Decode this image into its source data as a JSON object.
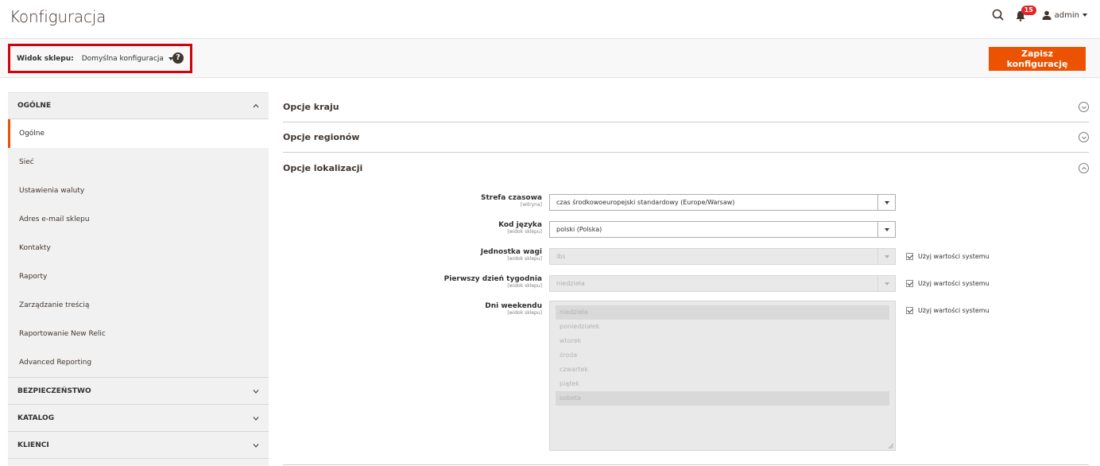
{
  "header": {
    "title": "Konfiguracja",
    "notifications_count": "15",
    "user": "admin"
  },
  "toolbar": {
    "scope_label": "Widok sklepu:",
    "scope_value": "Domyślna konfiguracja",
    "save_label": "Zapisz konfigurację"
  },
  "sidebar": {
    "general_section": "OGÓLNE",
    "items": [
      {
        "label": "Ogólne",
        "active": true
      },
      {
        "label": "Sieć"
      },
      {
        "label": "Ustawienia waluty"
      },
      {
        "label": "Adres e-mail sklepu"
      },
      {
        "label": "Kontakty"
      },
      {
        "label": "Raporty"
      },
      {
        "label": "Zarządzanie treścią"
      },
      {
        "label": "Raportowanie New Relic"
      },
      {
        "label": "Advanced Reporting"
      }
    ],
    "sections": [
      "BEZPIECZEŃSTWO",
      "KATALOG",
      "KLIENCI"
    ]
  },
  "main": {
    "groups": [
      "Opcje kraju",
      "Opcje regionów",
      "Opcje lokalizacji"
    ],
    "fields": {
      "timezone": {
        "label": "Strefa czasowa",
        "scope": "[witryna]",
        "value": "czas środkowoeuropejski standardowy (Europe/Warsaw)"
      },
      "locale": {
        "label": "Kod języka",
        "scope": "[widok sklepu]",
        "value": "polski (Polska)"
      },
      "weight_unit": {
        "label": "Jednostka wagi",
        "scope": "[widok sklepu]",
        "value": "lbs",
        "use_system": "Użyj wartości systemu"
      },
      "first_day": {
        "label": "Pierwszy dzień tygodnia",
        "scope": "[widok sklepu]",
        "value": "niedziela",
        "use_system": "Użyj wartości systemu"
      },
      "weekend": {
        "label": "Dni weekendu",
        "scope": "[widok sklepu]",
        "use_system": "Użyj wartości systemu",
        "options": [
          "niedziela",
          "poniedziałek",
          "wtorek",
          "środa",
          "czwartek",
          "piątek",
          "sobota"
        ]
      }
    }
  }
}
